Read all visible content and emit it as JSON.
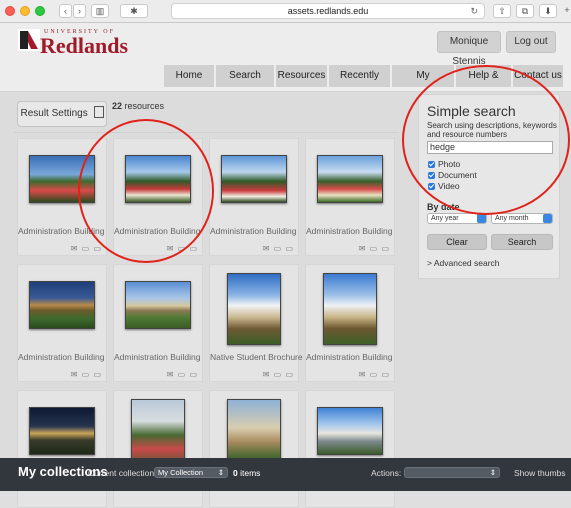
{
  "browser": {
    "url": "assets.redlands.edu",
    "reload_icon": "reload-icon",
    "share_icon": "share-icon",
    "tabs_icon": "tabs-icon",
    "download_icon": "download-icon",
    "newtab_icon": "plus-icon"
  },
  "logo": {
    "small": "UNIVERSITY OF",
    "name": "Redlands"
  },
  "header": {
    "user": "Monique Stennis",
    "logout": "Log out"
  },
  "nav": [
    "Home",
    "Search results",
    "Resources",
    "Recently added",
    "My contributions",
    "Help & advice",
    "Contact us"
  ],
  "results": {
    "settings_label": "Result Settings",
    "count": "22",
    "count_label": "resources"
  },
  "tiles": [
    {
      "caption": "Administration Building",
      "actions": "✉ ▭ ▭"
    },
    {
      "caption": "Administration Building",
      "actions": "✉ ▭ ▭"
    },
    {
      "caption": "Administration Building",
      "actions": "✉ ▭ ▭"
    },
    {
      "caption": "Administration Building",
      "actions": "✉ ▭ ▭"
    },
    {
      "caption": "Administration Building",
      "actions": "✉ ▭ ▭"
    },
    {
      "caption": "Administration Building",
      "actions": "✉ ▭ ▭"
    },
    {
      "caption": "Native Student Brochure",
      "actions": "✉ ▭ ▭"
    },
    {
      "caption": "Administration Building",
      "actions": "✉ ▭ ▭"
    },
    {
      "caption": "",
      "actions": ""
    },
    {
      "caption": "",
      "actions": ""
    },
    {
      "caption": "",
      "actions": ""
    },
    {
      "caption": "",
      "actions": ""
    }
  ],
  "search": {
    "title": "Simple search",
    "description": "Search using descriptions, keywords and resource numbers",
    "query": "hedge",
    "options": [
      "Photo",
      "Document",
      "Video"
    ],
    "by_date": "By date",
    "year": "Any year",
    "month": "Any month",
    "clear": "Clear",
    "submit": "Search",
    "advanced": "> Advanced search"
  },
  "collections": {
    "title": "My collections",
    "current_label": "Current collection:",
    "current": "My Collection",
    "items_count": "0",
    "items_label": "items",
    "actions_label": "Actions:",
    "show_thumbs": "Show thumbs"
  },
  "colors": {
    "accent_red": "#e0221a",
    "brand": "#a01a2a",
    "bar": "#32373d"
  }
}
